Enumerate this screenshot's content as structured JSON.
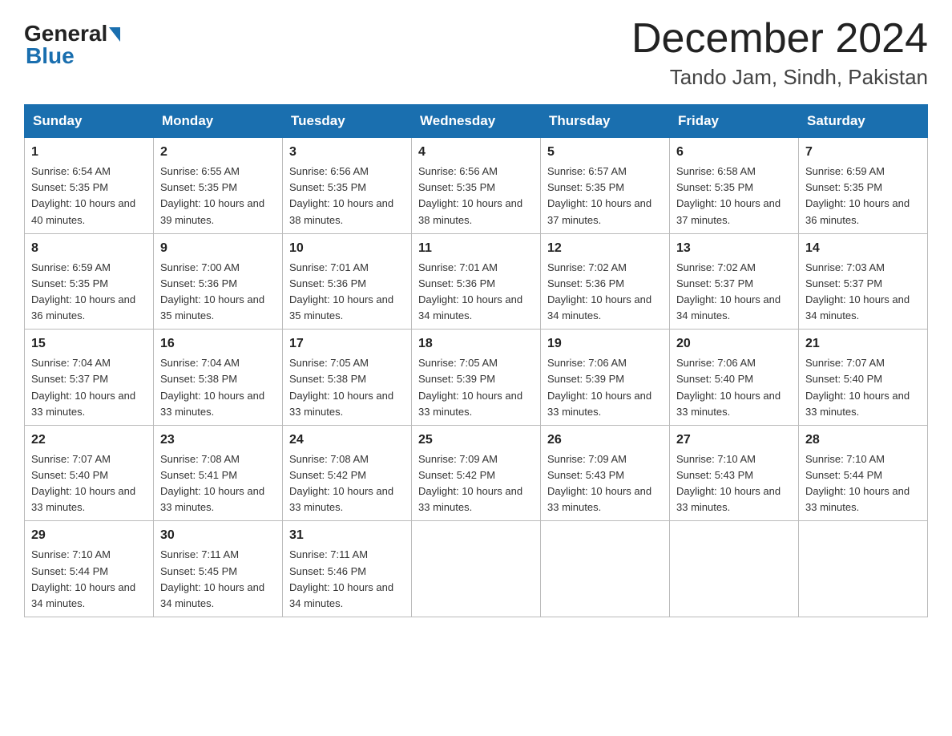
{
  "logo": {
    "general": "General",
    "blue": "Blue"
  },
  "title": "December 2024",
  "subtitle": "Tando Jam, Sindh, Pakistan",
  "days_header": [
    "Sunday",
    "Monday",
    "Tuesday",
    "Wednesday",
    "Thursday",
    "Friday",
    "Saturday"
  ],
  "weeks": [
    [
      {
        "num": "1",
        "sunrise": "6:54 AM",
        "sunset": "5:35 PM",
        "daylight": "10 hours and 40 minutes."
      },
      {
        "num": "2",
        "sunrise": "6:55 AM",
        "sunset": "5:35 PM",
        "daylight": "10 hours and 39 minutes."
      },
      {
        "num": "3",
        "sunrise": "6:56 AM",
        "sunset": "5:35 PM",
        "daylight": "10 hours and 38 minutes."
      },
      {
        "num": "4",
        "sunrise": "6:56 AM",
        "sunset": "5:35 PM",
        "daylight": "10 hours and 38 minutes."
      },
      {
        "num": "5",
        "sunrise": "6:57 AM",
        "sunset": "5:35 PM",
        "daylight": "10 hours and 37 minutes."
      },
      {
        "num": "6",
        "sunrise": "6:58 AM",
        "sunset": "5:35 PM",
        "daylight": "10 hours and 37 minutes."
      },
      {
        "num": "7",
        "sunrise": "6:59 AM",
        "sunset": "5:35 PM",
        "daylight": "10 hours and 36 minutes."
      }
    ],
    [
      {
        "num": "8",
        "sunrise": "6:59 AM",
        "sunset": "5:35 PM",
        "daylight": "10 hours and 36 minutes."
      },
      {
        "num": "9",
        "sunrise": "7:00 AM",
        "sunset": "5:36 PM",
        "daylight": "10 hours and 35 minutes."
      },
      {
        "num": "10",
        "sunrise": "7:01 AM",
        "sunset": "5:36 PM",
        "daylight": "10 hours and 35 minutes."
      },
      {
        "num": "11",
        "sunrise": "7:01 AM",
        "sunset": "5:36 PM",
        "daylight": "10 hours and 34 minutes."
      },
      {
        "num": "12",
        "sunrise": "7:02 AM",
        "sunset": "5:36 PM",
        "daylight": "10 hours and 34 minutes."
      },
      {
        "num": "13",
        "sunrise": "7:02 AM",
        "sunset": "5:37 PM",
        "daylight": "10 hours and 34 minutes."
      },
      {
        "num": "14",
        "sunrise": "7:03 AM",
        "sunset": "5:37 PM",
        "daylight": "10 hours and 34 minutes."
      }
    ],
    [
      {
        "num": "15",
        "sunrise": "7:04 AM",
        "sunset": "5:37 PM",
        "daylight": "10 hours and 33 minutes."
      },
      {
        "num": "16",
        "sunrise": "7:04 AM",
        "sunset": "5:38 PM",
        "daylight": "10 hours and 33 minutes."
      },
      {
        "num": "17",
        "sunrise": "7:05 AM",
        "sunset": "5:38 PM",
        "daylight": "10 hours and 33 minutes."
      },
      {
        "num": "18",
        "sunrise": "7:05 AM",
        "sunset": "5:39 PM",
        "daylight": "10 hours and 33 minutes."
      },
      {
        "num": "19",
        "sunrise": "7:06 AM",
        "sunset": "5:39 PM",
        "daylight": "10 hours and 33 minutes."
      },
      {
        "num": "20",
        "sunrise": "7:06 AM",
        "sunset": "5:40 PM",
        "daylight": "10 hours and 33 minutes."
      },
      {
        "num": "21",
        "sunrise": "7:07 AM",
        "sunset": "5:40 PM",
        "daylight": "10 hours and 33 minutes."
      }
    ],
    [
      {
        "num": "22",
        "sunrise": "7:07 AM",
        "sunset": "5:40 PM",
        "daylight": "10 hours and 33 minutes."
      },
      {
        "num": "23",
        "sunrise": "7:08 AM",
        "sunset": "5:41 PM",
        "daylight": "10 hours and 33 minutes."
      },
      {
        "num": "24",
        "sunrise": "7:08 AM",
        "sunset": "5:42 PM",
        "daylight": "10 hours and 33 minutes."
      },
      {
        "num": "25",
        "sunrise": "7:09 AM",
        "sunset": "5:42 PM",
        "daylight": "10 hours and 33 minutes."
      },
      {
        "num": "26",
        "sunrise": "7:09 AM",
        "sunset": "5:43 PM",
        "daylight": "10 hours and 33 minutes."
      },
      {
        "num": "27",
        "sunrise": "7:10 AM",
        "sunset": "5:43 PM",
        "daylight": "10 hours and 33 minutes."
      },
      {
        "num": "28",
        "sunrise": "7:10 AM",
        "sunset": "5:44 PM",
        "daylight": "10 hours and 33 minutes."
      }
    ],
    [
      {
        "num": "29",
        "sunrise": "7:10 AM",
        "sunset": "5:44 PM",
        "daylight": "10 hours and 34 minutes."
      },
      {
        "num": "30",
        "sunrise": "7:11 AM",
        "sunset": "5:45 PM",
        "daylight": "10 hours and 34 minutes."
      },
      {
        "num": "31",
        "sunrise": "7:11 AM",
        "sunset": "5:46 PM",
        "daylight": "10 hours and 34 minutes."
      },
      null,
      null,
      null,
      null
    ]
  ]
}
